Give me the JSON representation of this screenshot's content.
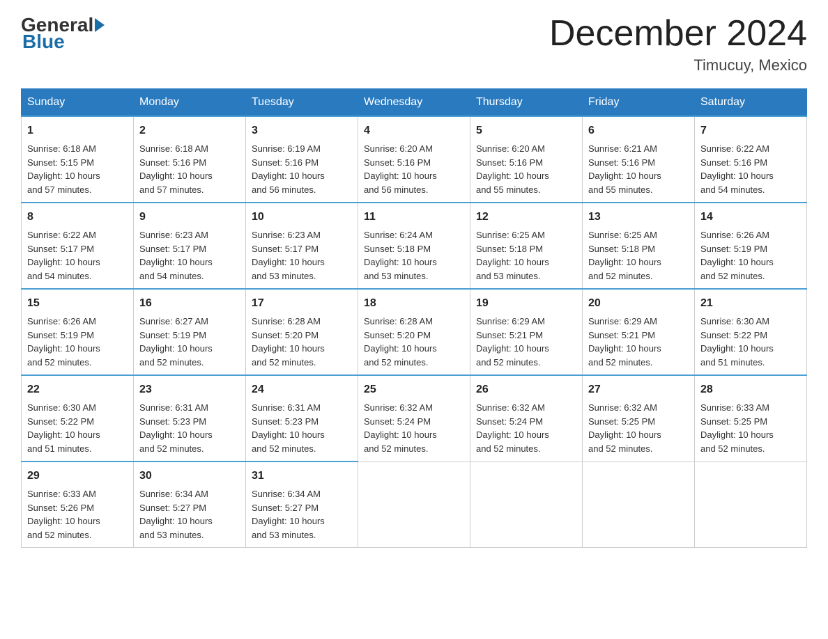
{
  "header": {
    "logo_general": "General",
    "logo_blue": "Blue",
    "month_title": "December 2024",
    "location": "Timucuy, Mexico"
  },
  "days_of_week": [
    "Sunday",
    "Monday",
    "Tuesday",
    "Wednesday",
    "Thursday",
    "Friday",
    "Saturday"
  ],
  "weeks": [
    [
      {
        "day": "1",
        "sunrise": "6:18 AM",
        "sunset": "5:15 PM",
        "daylight": "10 hours and 57 minutes."
      },
      {
        "day": "2",
        "sunrise": "6:18 AM",
        "sunset": "5:16 PM",
        "daylight": "10 hours and 57 minutes."
      },
      {
        "day": "3",
        "sunrise": "6:19 AM",
        "sunset": "5:16 PM",
        "daylight": "10 hours and 56 minutes."
      },
      {
        "day": "4",
        "sunrise": "6:20 AM",
        "sunset": "5:16 PM",
        "daylight": "10 hours and 56 minutes."
      },
      {
        "day": "5",
        "sunrise": "6:20 AM",
        "sunset": "5:16 PM",
        "daylight": "10 hours and 55 minutes."
      },
      {
        "day": "6",
        "sunrise": "6:21 AM",
        "sunset": "5:16 PM",
        "daylight": "10 hours and 55 minutes."
      },
      {
        "day": "7",
        "sunrise": "6:22 AM",
        "sunset": "5:16 PM",
        "daylight": "10 hours and 54 minutes."
      }
    ],
    [
      {
        "day": "8",
        "sunrise": "6:22 AM",
        "sunset": "5:17 PM",
        "daylight": "10 hours and 54 minutes."
      },
      {
        "day": "9",
        "sunrise": "6:23 AM",
        "sunset": "5:17 PM",
        "daylight": "10 hours and 54 minutes."
      },
      {
        "day": "10",
        "sunrise": "6:23 AM",
        "sunset": "5:17 PM",
        "daylight": "10 hours and 53 minutes."
      },
      {
        "day": "11",
        "sunrise": "6:24 AM",
        "sunset": "5:18 PM",
        "daylight": "10 hours and 53 minutes."
      },
      {
        "day": "12",
        "sunrise": "6:25 AM",
        "sunset": "5:18 PM",
        "daylight": "10 hours and 53 minutes."
      },
      {
        "day": "13",
        "sunrise": "6:25 AM",
        "sunset": "5:18 PM",
        "daylight": "10 hours and 52 minutes."
      },
      {
        "day": "14",
        "sunrise": "6:26 AM",
        "sunset": "5:19 PM",
        "daylight": "10 hours and 52 minutes."
      }
    ],
    [
      {
        "day": "15",
        "sunrise": "6:26 AM",
        "sunset": "5:19 PM",
        "daylight": "10 hours and 52 minutes."
      },
      {
        "day": "16",
        "sunrise": "6:27 AM",
        "sunset": "5:19 PM",
        "daylight": "10 hours and 52 minutes."
      },
      {
        "day": "17",
        "sunrise": "6:28 AM",
        "sunset": "5:20 PM",
        "daylight": "10 hours and 52 minutes."
      },
      {
        "day": "18",
        "sunrise": "6:28 AM",
        "sunset": "5:20 PM",
        "daylight": "10 hours and 52 minutes."
      },
      {
        "day": "19",
        "sunrise": "6:29 AM",
        "sunset": "5:21 PM",
        "daylight": "10 hours and 52 minutes."
      },
      {
        "day": "20",
        "sunrise": "6:29 AM",
        "sunset": "5:21 PM",
        "daylight": "10 hours and 52 minutes."
      },
      {
        "day": "21",
        "sunrise": "6:30 AM",
        "sunset": "5:22 PM",
        "daylight": "10 hours and 51 minutes."
      }
    ],
    [
      {
        "day": "22",
        "sunrise": "6:30 AM",
        "sunset": "5:22 PM",
        "daylight": "10 hours and 51 minutes."
      },
      {
        "day": "23",
        "sunrise": "6:31 AM",
        "sunset": "5:23 PM",
        "daylight": "10 hours and 52 minutes."
      },
      {
        "day": "24",
        "sunrise": "6:31 AM",
        "sunset": "5:23 PM",
        "daylight": "10 hours and 52 minutes."
      },
      {
        "day": "25",
        "sunrise": "6:32 AM",
        "sunset": "5:24 PM",
        "daylight": "10 hours and 52 minutes."
      },
      {
        "day": "26",
        "sunrise": "6:32 AM",
        "sunset": "5:24 PM",
        "daylight": "10 hours and 52 minutes."
      },
      {
        "day": "27",
        "sunrise": "6:32 AM",
        "sunset": "5:25 PM",
        "daylight": "10 hours and 52 minutes."
      },
      {
        "day": "28",
        "sunrise": "6:33 AM",
        "sunset": "5:25 PM",
        "daylight": "10 hours and 52 minutes."
      }
    ],
    [
      {
        "day": "29",
        "sunrise": "6:33 AM",
        "sunset": "5:26 PM",
        "daylight": "10 hours and 52 minutes."
      },
      {
        "day": "30",
        "sunrise": "6:34 AM",
        "sunset": "5:27 PM",
        "daylight": "10 hours and 53 minutes."
      },
      {
        "day": "31",
        "sunrise": "6:34 AM",
        "sunset": "5:27 PM",
        "daylight": "10 hours and 53 minutes."
      },
      null,
      null,
      null,
      null
    ]
  ],
  "labels": {
    "sunrise": "Sunrise:",
    "sunset": "Sunset:",
    "daylight": "Daylight:"
  }
}
